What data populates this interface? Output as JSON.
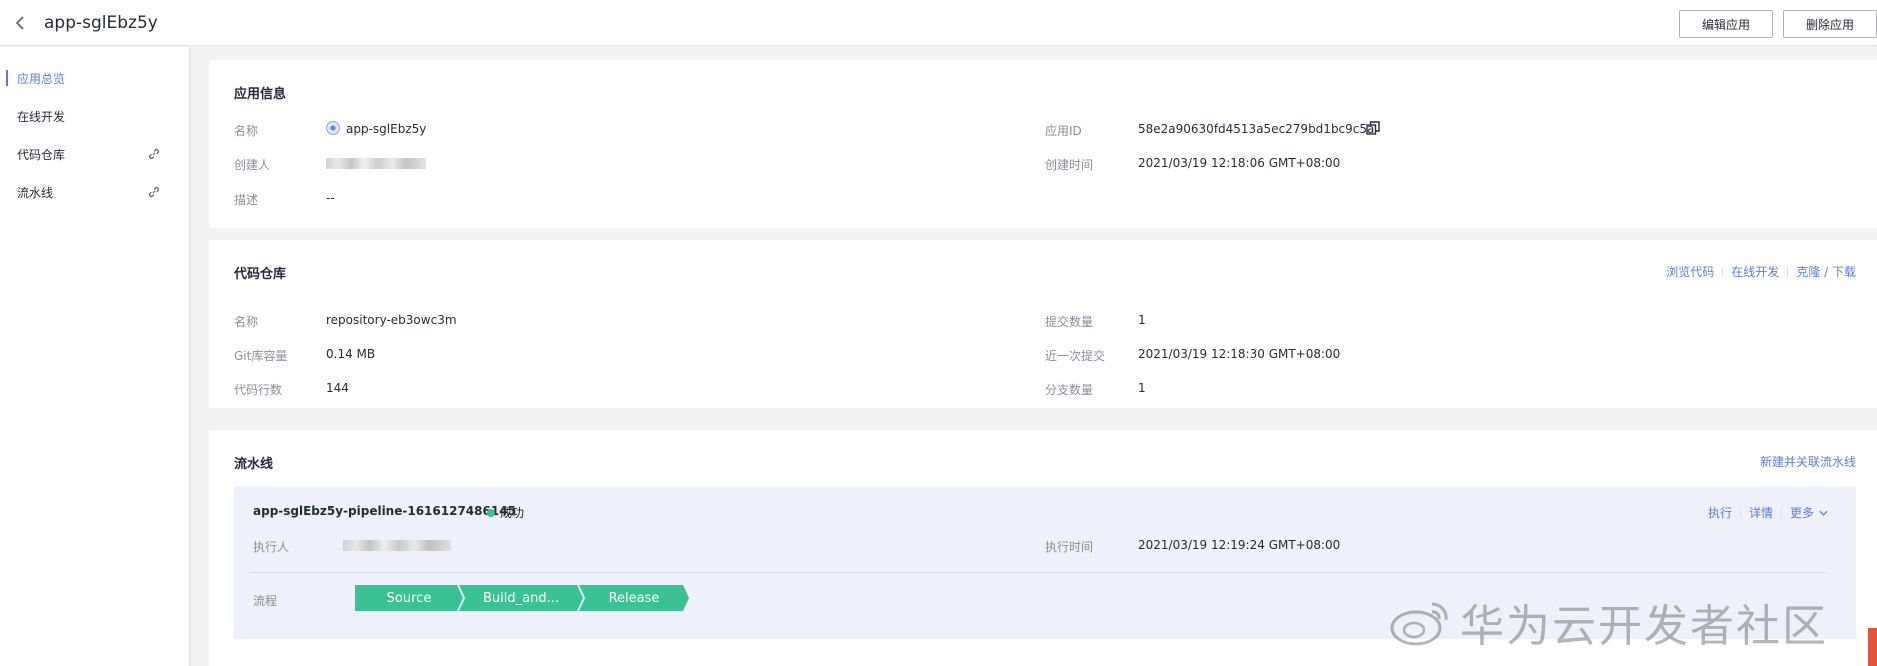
{
  "header": {
    "title": "app-sglEbz5y",
    "edit_label": "编辑应用",
    "delete_label": "删除应用"
  },
  "sidebar": {
    "items": [
      {
        "label": "应用总览",
        "active": true
      },
      {
        "label": "在线开发"
      },
      {
        "label": "代码仓库",
        "icon": "link-icon"
      },
      {
        "label": "流水线",
        "icon": "link-icon"
      }
    ]
  },
  "app_info": {
    "title": "应用信息",
    "name_label": "名称",
    "name_value": "app-sglEbz5y",
    "creator_label": "创建人",
    "desc_label": "描述",
    "desc_value": "--",
    "id_label": "应用ID",
    "id_value": "58e2a90630fd4513a5ec279bd1bc9c5a",
    "created_label": "创建时间",
    "created_value": "2021/03/19 12:18:06 GMT+08:00"
  },
  "repo": {
    "title": "代码仓库",
    "links": [
      "浏览代码",
      "在线开发",
      "克隆 / 下载"
    ],
    "name_label": "名称",
    "name_value": "repository-eb3owc3m",
    "size_label": "Git库容量",
    "size_value": "0.14 MB",
    "lines_label": "代码行数",
    "lines_value": "144",
    "commits_label": "提交数量",
    "commits_value": "1",
    "last_commit_label": "近一次提交",
    "last_commit_value": "2021/03/19 12:18:30 GMT+08:00",
    "branches_label": "分支数量",
    "branches_value": "1"
  },
  "pipeline": {
    "title": "流水线",
    "create_link": "新建并关联流水线",
    "name": "app-sglEbz5y-pipeline-1616127486145",
    "status": "成功",
    "status_color": "#3ac295",
    "actions": [
      "执行",
      "详情",
      "更多"
    ],
    "executor_label": "执行人",
    "exec_time_label": "执行时间",
    "exec_time_value": "2021/03/19 12:19:24 GMT+08:00",
    "flow_label": "流程",
    "stages": [
      "Source",
      "Build_and...",
      "Release"
    ]
  },
  "watermark": "华为云开发者社区",
  "colors": {
    "accent": "#5e7ce0",
    "success": "#3ac295"
  }
}
